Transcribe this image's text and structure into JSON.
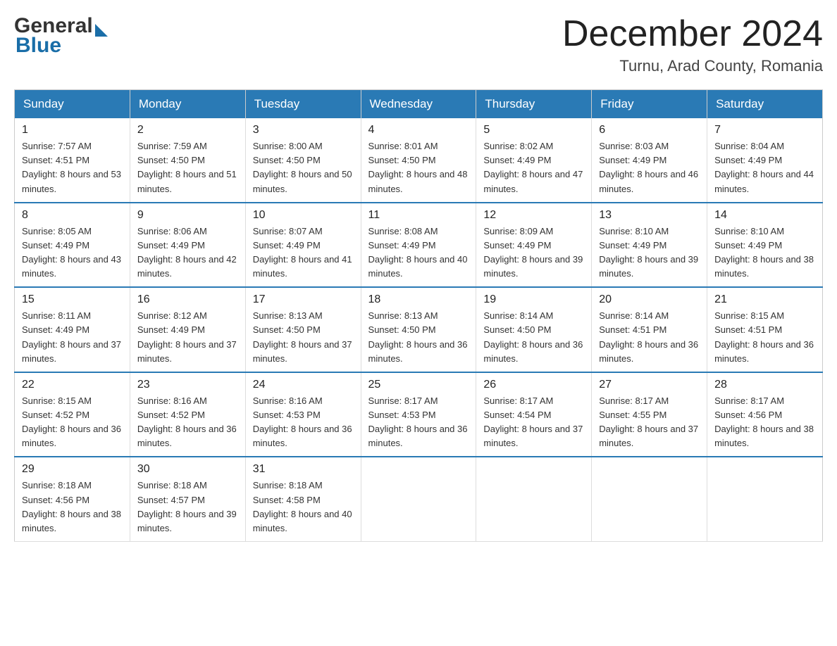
{
  "logo": {
    "general": "General",
    "blue": "Blue",
    "tagline": "Blue"
  },
  "header": {
    "month_year": "December 2024",
    "location": "Turnu, Arad County, Romania"
  },
  "weekdays": [
    "Sunday",
    "Monday",
    "Tuesday",
    "Wednesday",
    "Thursday",
    "Friday",
    "Saturday"
  ],
  "weeks": [
    [
      {
        "day": "1",
        "sunrise": "7:57 AM",
        "sunset": "4:51 PM",
        "daylight": "8 hours and 53 minutes."
      },
      {
        "day": "2",
        "sunrise": "7:59 AM",
        "sunset": "4:50 PM",
        "daylight": "8 hours and 51 minutes."
      },
      {
        "day": "3",
        "sunrise": "8:00 AM",
        "sunset": "4:50 PM",
        "daylight": "8 hours and 50 minutes."
      },
      {
        "day": "4",
        "sunrise": "8:01 AM",
        "sunset": "4:50 PM",
        "daylight": "8 hours and 48 minutes."
      },
      {
        "day": "5",
        "sunrise": "8:02 AM",
        "sunset": "4:49 PM",
        "daylight": "8 hours and 47 minutes."
      },
      {
        "day": "6",
        "sunrise": "8:03 AM",
        "sunset": "4:49 PM",
        "daylight": "8 hours and 46 minutes."
      },
      {
        "day": "7",
        "sunrise": "8:04 AM",
        "sunset": "4:49 PM",
        "daylight": "8 hours and 44 minutes."
      }
    ],
    [
      {
        "day": "8",
        "sunrise": "8:05 AM",
        "sunset": "4:49 PM",
        "daylight": "8 hours and 43 minutes."
      },
      {
        "day": "9",
        "sunrise": "8:06 AM",
        "sunset": "4:49 PM",
        "daylight": "8 hours and 42 minutes."
      },
      {
        "day": "10",
        "sunrise": "8:07 AM",
        "sunset": "4:49 PM",
        "daylight": "8 hours and 41 minutes."
      },
      {
        "day": "11",
        "sunrise": "8:08 AM",
        "sunset": "4:49 PM",
        "daylight": "8 hours and 40 minutes."
      },
      {
        "day": "12",
        "sunrise": "8:09 AM",
        "sunset": "4:49 PM",
        "daylight": "8 hours and 39 minutes."
      },
      {
        "day": "13",
        "sunrise": "8:10 AM",
        "sunset": "4:49 PM",
        "daylight": "8 hours and 39 minutes."
      },
      {
        "day": "14",
        "sunrise": "8:10 AM",
        "sunset": "4:49 PM",
        "daylight": "8 hours and 38 minutes."
      }
    ],
    [
      {
        "day": "15",
        "sunrise": "8:11 AM",
        "sunset": "4:49 PM",
        "daylight": "8 hours and 37 minutes."
      },
      {
        "day": "16",
        "sunrise": "8:12 AM",
        "sunset": "4:49 PM",
        "daylight": "8 hours and 37 minutes."
      },
      {
        "day": "17",
        "sunrise": "8:13 AM",
        "sunset": "4:50 PM",
        "daylight": "8 hours and 37 minutes."
      },
      {
        "day": "18",
        "sunrise": "8:13 AM",
        "sunset": "4:50 PM",
        "daylight": "8 hours and 36 minutes."
      },
      {
        "day": "19",
        "sunrise": "8:14 AM",
        "sunset": "4:50 PM",
        "daylight": "8 hours and 36 minutes."
      },
      {
        "day": "20",
        "sunrise": "8:14 AM",
        "sunset": "4:51 PM",
        "daylight": "8 hours and 36 minutes."
      },
      {
        "day": "21",
        "sunrise": "8:15 AM",
        "sunset": "4:51 PM",
        "daylight": "8 hours and 36 minutes."
      }
    ],
    [
      {
        "day": "22",
        "sunrise": "8:15 AM",
        "sunset": "4:52 PM",
        "daylight": "8 hours and 36 minutes."
      },
      {
        "day": "23",
        "sunrise": "8:16 AM",
        "sunset": "4:52 PM",
        "daylight": "8 hours and 36 minutes."
      },
      {
        "day": "24",
        "sunrise": "8:16 AM",
        "sunset": "4:53 PM",
        "daylight": "8 hours and 36 minutes."
      },
      {
        "day": "25",
        "sunrise": "8:17 AM",
        "sunset": "4:53 PM",
        "daylight": "8 hours and 36 minutes."
      },
      {
        "day": "26",
        "sunrise": "8:17 AM",
        "sunset": "4:54 PM",
        "daylight": "8 hours and 37 minutes."
      },
      {
        "day": "27",
        "sunrise": "8:17 AM",
        "sunset": "4:55 PM",
        "daylight": "8 hours and 37 minutes."
      },
      {
        "day": "28",
        "sunrise": "8:17 AM",
        "sunset": "4:56 PM",
        "daylight": "8 hours and 38 minutes."
      }
    ],
    [
      {
        "day": "29",
        "sunrise": "8:18 AM",
        "sunset": "4:56 PM",
        "daylight": "8 hours and 38 minutes."
      },
      {
        "day": "30",
        "sunrise": "8:18 AM",
        "sunset": "4:57 PM",
        "daylight": "8 hours and 39 minutes."
      },
      {
        "day": "31",
        "sunrise": "8:18 AM",
        "sunset": "4:58 PM",
        "daylight": "8 hours and 40 minutes."
      },
      null,
      null,
      null,
      null
    ]
  ]
}
